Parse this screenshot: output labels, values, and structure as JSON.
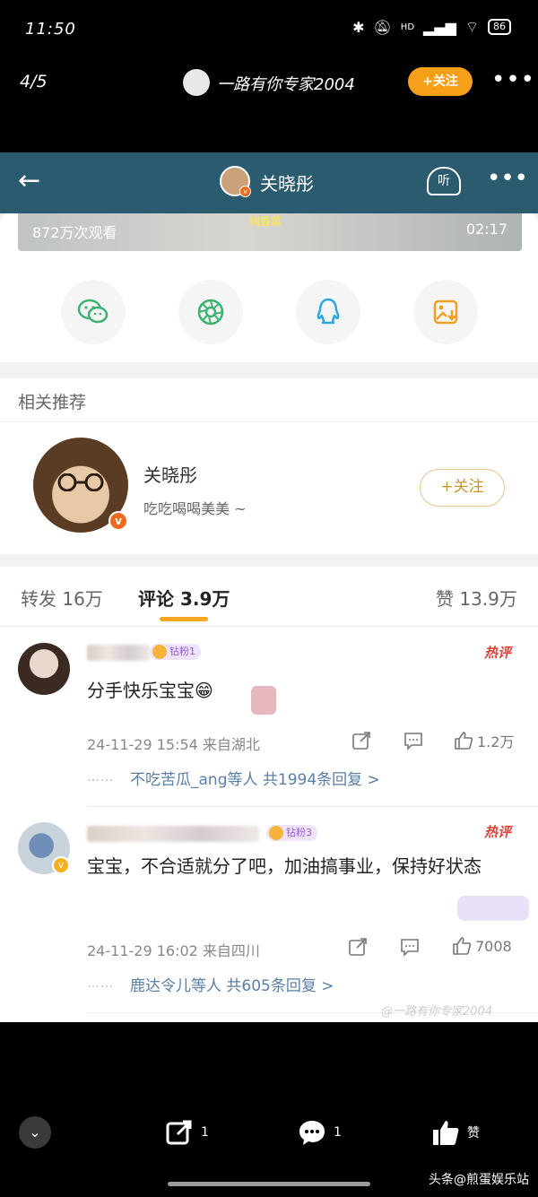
{
  "status": {
    "time": "11:50",
    "battery": "86",
    "signal": "HD"
  },
  "viewer": {
    "counter": "4/5",
    "poster_name": "一路有你专家2004",
    "follow_label": "+关注"
  },
  "nav": {
    "title": "关晓彤",
    "listen_label": "听"
  },
  "video": {
    "views": "872万次观看",
    "caption": "纯香菜",
    "duration": "02:17"
  },
  "share_icons": [
    "wechat-icon",
    "moments-icon",
    "qq-icon",
    "save-image-icon"
  ],
  "related": {
    "header": "相关推荐",
    "name": "关晓彤",
    "bio": "吃吃喝喝美美 ~",
    "follow_label": "+关注"
  },
  "tabs": {
    "repost": "转发 16万",
    "comments": "评论 3.9万",
    "likes": "赞 13.9万"
  },
  "comments": [
    {
      "badge": "钻粉1",
      "hot": "热评",
      "text": "分手快乐宝宝😁",
      "meta": "24-11-29 15:54 来自湖北",
      "likes": "1.2万",
      "replies": "不吃苦瓜_ang等人 共1994条回复 >"
    },
    {
      "badge": "钻粉3",
      "hot": "热评",
      "text": "宝宝，不合适就分了吧，加油搞事业，保持好状态",
      "meta": "24-11-29 16:02 来自四川",
      "likes": "7008",
      "replies": "鹿达令儿等人 共605条回复 >"
    }
  ],
  "watermark": "@一路有你专家2004",
  "toolbar": {
    "share_count": "1",
    "comment_count": "1",
    "like_label": "赞"
  },
  "brand": "头条@煎蛋娱乐站",
  "colors": {
    "nav_bg": "#2b5b6e",
    "accent": "#f5a623",
    "follow_orange": "#f6a01a",
    "hot_red": "#e0413b"
  }
}
